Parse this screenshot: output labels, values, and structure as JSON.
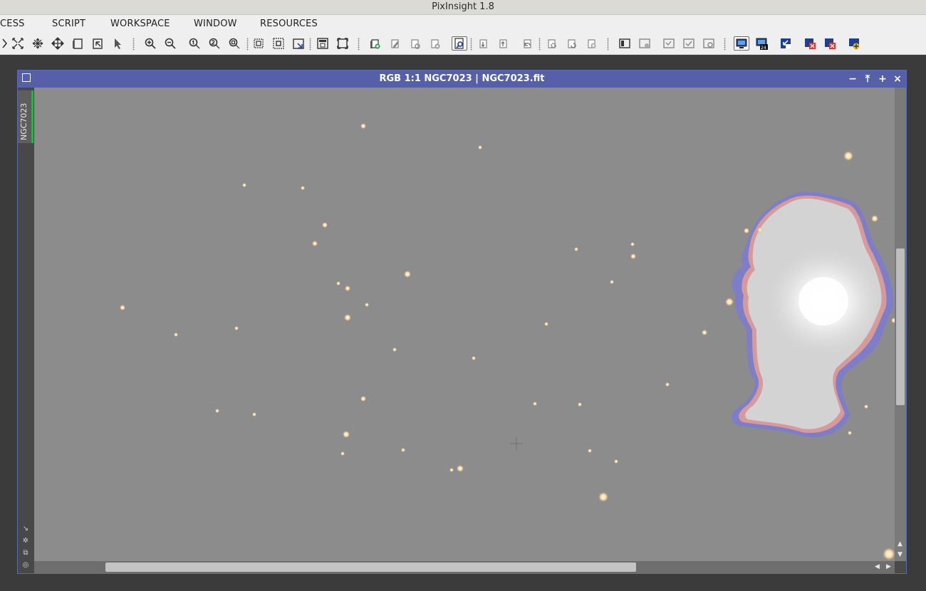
{
  "app": {
    "title": "PixInsight 1.8"
  },
  "menu": {
    "items": [
      {
        "id": "process",
        "label": "CESS"
      },
      {
        "id": "script",
        "label": "SCRIPT"
      },
      {
        "id": "workspace",
        "label": "WORKSPACE"
      },
      {
        "id": "window",
        "label": "WINDOW"
      },
      {
        "id": "resources",
        "label": "RESOURCES"
      }
    ]
  },
  "toolbar": {
    "tools": [
      "fit-view-icon",
      "move-view-icon",
      "pan-icon",
      "zoom-mode-icon",
      "zoom-in-icon",
      "zoom-out-icon",
      "zoom-1-1-icon",
      "zoom-fit-icon",
      "new-preview-icon",
      "fit-window-icon",
      "screen-stf-icon",
      "stf-24bit-icon"
    ]
  },
  "image_window": {
    "title": "RGB 1:1 NGC7023 | NGC7023.fit",
    "view_tab": "NGC7023",
    "buttons": {
      "minimize": "−",
      "shade": "⤒",
      "maximize": "+",
      "close": "×"
    }
  },
  "colors": {
    "window_title_bg": "#5560a8",
    "canvas_bg": "#8c8c8c",
    "active_tab_accent": "#2fae4b"
  }
}
